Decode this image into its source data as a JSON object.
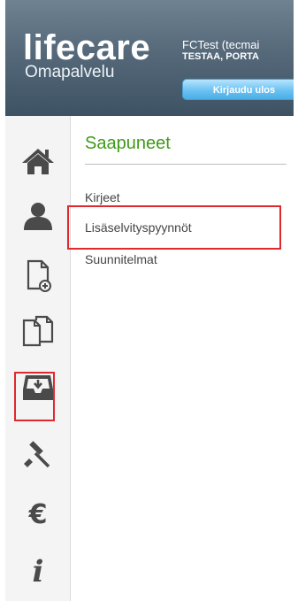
{
  "header": {
    "brand_name": "lifecare",
    "brand_sub": "Omapalvelu",
    "user_name": "FCTest (tecmai",
    "user_org": "TESTAA, PORTA",
    "logout_label": "Kirjaudu ulos"
  },
  "nav_rail": {
    "items": [
      {
        "icon": "home-icon"
      },
      {
        "icon": "user-icon"
      },
      {
        "icon": "new-document-icon"
      },
      {
        "icon": "documents-icon"
      },
      {
        "icon": "inbox-icon",
        "active": true
      },
      {
        "icon": "gavel-icon"
      },
      {
        "icon": "euro-icon"
      },
      {
        "icon": "info-icon"
      }
    ]
  },
  "main": {
    "title": "Saapuneet",
    "items": [
      {
        "label": "Kirjeet"
      },
      {
        "label": "Lisäselvityspyynnöt",
        "highlighted": true
      },
      {
        "label": "Suunnitelmat"
      }
    ]
  },
  "colors": {
    "header_top": "#6f8291",
    "header_bottom": "#3d5263",
    "title_green": "#3f9a1a",
    "highlight_red": "#e0282f",
    "icon_dark": "#4a4a4a",
    "button_blue": "#6cc2f2"
  }
}
